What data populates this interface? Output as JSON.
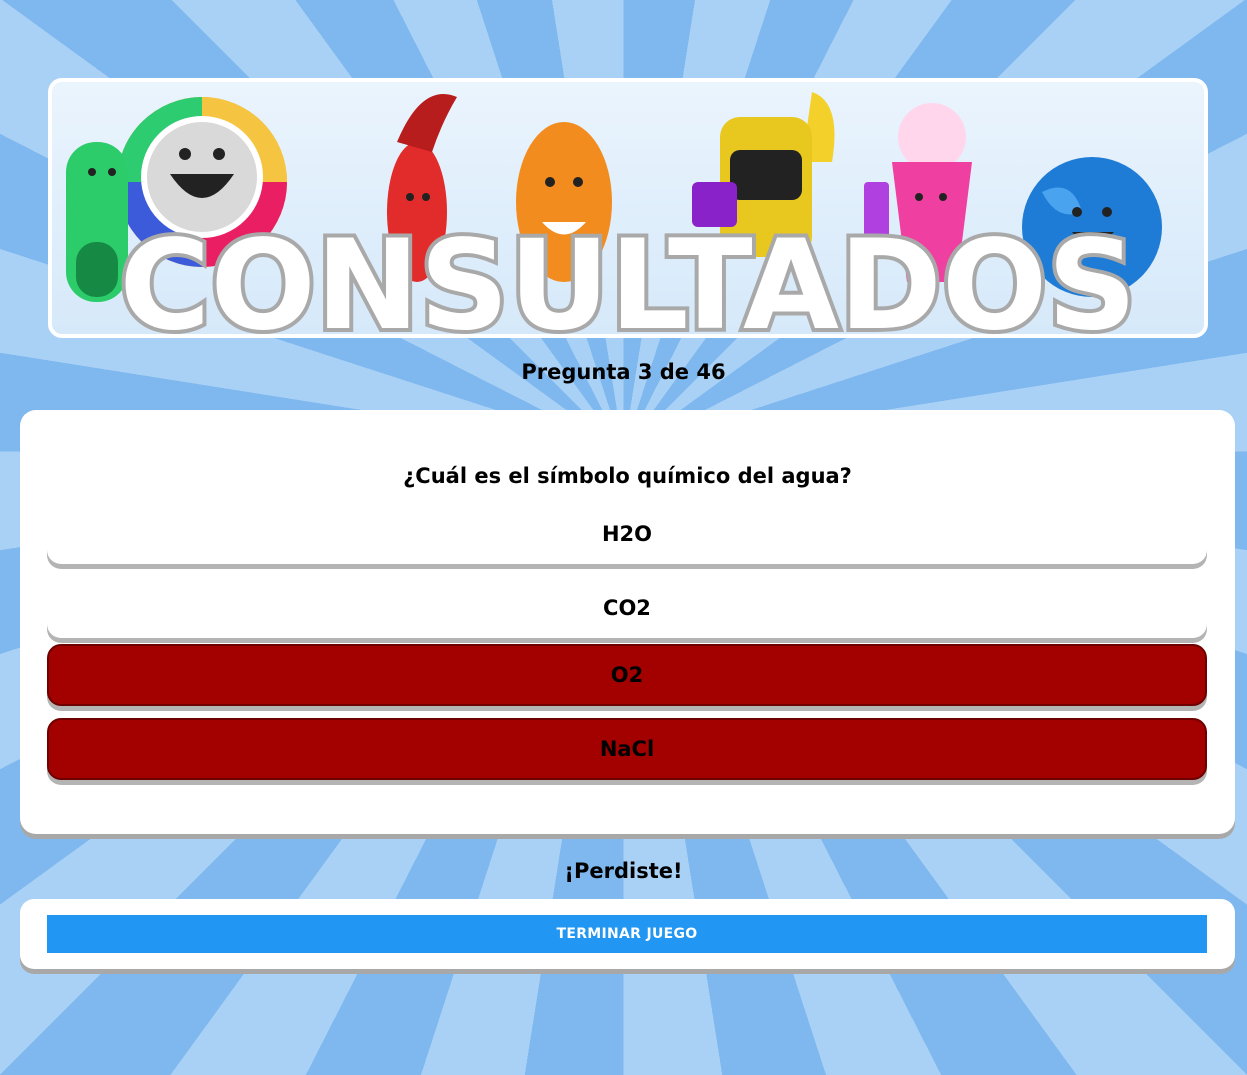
{
  "banner": {
    "title": "CONSULTADOS"
  },
  "progress": {
    "text": "Pregunta 3 de 46"
  },
  "question": {
    "text": "¿Cuál es el símbolo químico del agua?",
    "answers": [
      {
        "label": "H2O",
        "state": "neutral"
      },
      {
        "label": "CO2",
        "state": "neutral"
      },
      {
        "label": "O2",
        "state": "wrong"
      },
      {
        "label": "NaCl",
        "state": "wrong"
      }
    ]
  },
  "result": {
    "text": "¡Perdiste!"
  },
  "actions": {
    "end_label": "TERMINAR JUEGO"
  },
  "colors": {
    "wrong": "#a30000",
    "primary": "#2196f3",
    "card": "#ffffff"
  }
}
